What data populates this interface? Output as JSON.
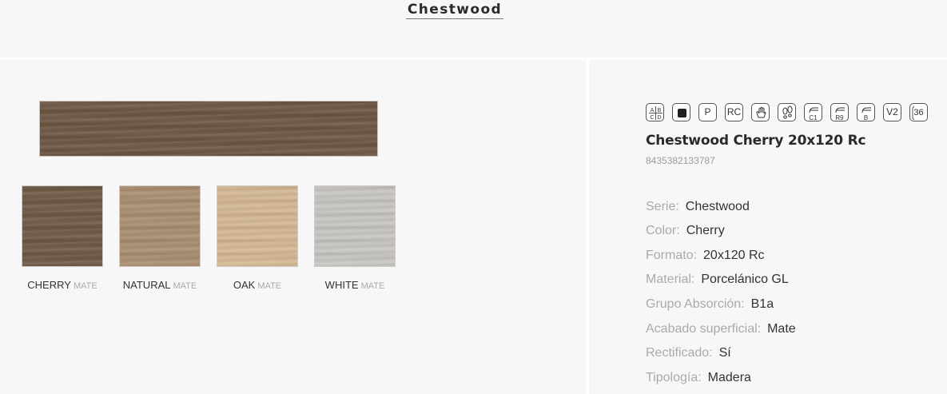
{
  "header": {
    "series_title": "Chestwood"
  },
  "variants": [
    {
      "name": "CHERRY",
      "finish": "MATE",
      "color": "#6f5a48"
    },
    {
      "name": "NATURAL",
      "finish": "MATE",
      "color": "#a98e72"
    },
    {
      "name": "OAK",
      "finish": "MATE",
      "color": "#d3b892"
    },
    {
      "name": "WHITE",
      "finish": "MATE",
      "color": "#c7c5c2"
    }
  ],
  "main_tile": {
    "color": "#6e5745"
  },
  "icons": [
    {
      "name": "abcd-grade-icon",
      "text": ""
    },
    {
      "name": "full-body-color-icon",
      "text": ""
    },
    {
      "name": "porcelain-p-icon",
      "text": "P"
    },
    {
      "name": "rectified-rc-icon",
      "text": "RC"
    },
    {
      "name": "touch-hand-icon",
      "text": ""
    },
    {
      "name": "footsteps-icon",
      "text": ""
    },
    {
      "name": "slip-c1-icon",
      "text": "C1"
    },
    {
      "name": "slip-r9-icon",
      "text": "R9"
    },
    {
      "name": "slip-b-icon",
      "text": "B"
    },
    {
      "name": "variation-v2-icon",
      "text": "V2"
    },
    {
      "name": "pieces-36-icon",
      "text": "36"
    }
  ],
  "product": {
    "name": "Chestwood Cherry 20x120 Rc",
    "ean": "8435382133787",
    "specs": [
      {
        "key": "Serie:",
        "value": "Chestwood"
      },
      {
        "key": "Color:",
        "value": "Cherry"
      },
      {
        "key": "Formato:",
        "value": "20x120 Rc"
      },
      {
        "key": "Material:",
        "value": "Porcelánico GL"
      },
      {
        "key": "Grupo Absorción:",
        "value": "B1a"
      },
      {
        "key": "Acabado superficial:",
        "value": "Mate"
      },
      {
        "key": "Rectificado:",
        "value": "Sí"
      },
      {
        "key": "Tipología:",
        "value": "Madera"
      }
    ]
  }
}
